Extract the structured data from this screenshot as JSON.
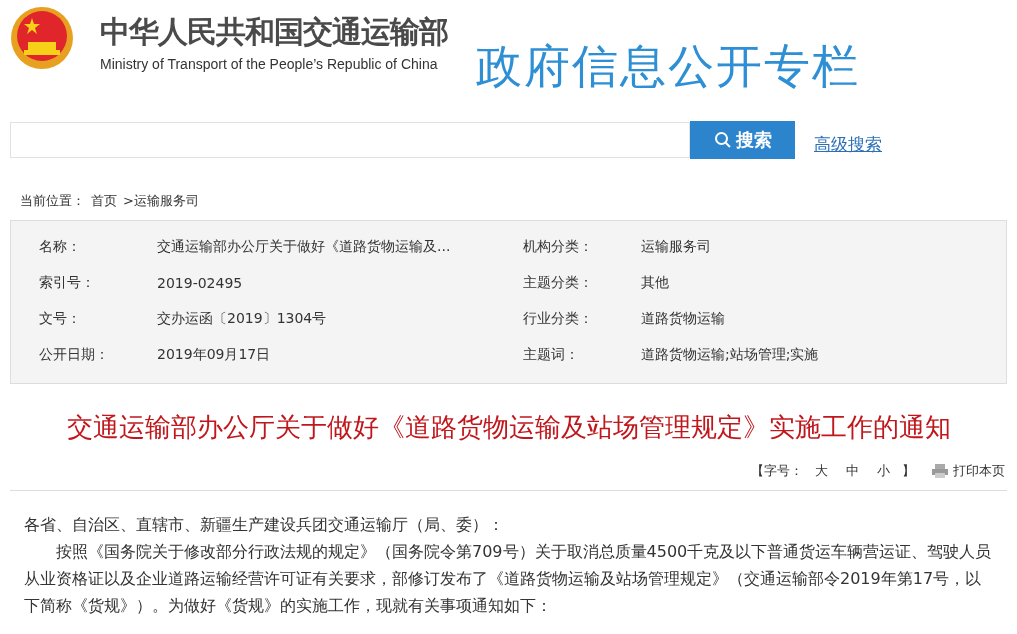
{
  "header": {
    "name_cn": "中华人民共和国交通运输部",
    "name_en": "Ministry of Transport of the People’s Republic of China",
    "column_title": "政府信息公开专栏"
  },
  "search": {
    "button": "搜索",
    "advanced": "高级搜索"
  },
  "breadcrumb": {
    "label": "当前位置：",
    "items": [
      "首页",
      ">运输服务司"
    ]
  },
  "info": [
    {
      "label": "名称：",
      "value": "交通运输部办公厅关于做好《道路货物运输及..."
    },
    {
      "label": "机构分类：",
      "value": "运输服务司"
    },
    {
      "label": "索引号：",
      "value": "2019-02495"
    },
    {
      "label": "主题分类：",
      "value": "其他"
    },
    {
      "label": "文号：",
      "value": "交办运函〔2019〕1304号"
    },
    {
      "label": "行业分类：",
      "value": "道路货物运输"
    },
    {
      "label": "公开日期：",
      "value": "2019年09月17日"
    },
    {
      "label": "主题词：",
      "value": "道路货物运输;站场管理;实施"
    }
  ],
  "article": {
    "title": "交通运输部办公厅关于做好《道路货物运输及站场管理规定》实施工作的通知",
    "font_size_label": "【字号：",
    "font_sizes": [
      "大",
      "中",
      "小"
    ],
    "font_size_end": "】",
    "print": "打印本页",
    "salutation": "各省、自治区、直辖市、新疆生产建设兵团交通运输厅（局、委）：",
    "paragraphs": [
      "按照《国务院关于修改部分行政法规的规定》（国务院令第709号）关于取消总质量4500千克及以下普通货运车辆营运证、驾驶人员从业资格证以及企业道路运输经营许可证有关要求，部修订发布了《道路货物运输及站场管理规定》（交通运输部令2019年第17号，以下简称《货规》）。为做好《货规》的实施工作，现就有关事项通知如下："
    ]
  }
}
